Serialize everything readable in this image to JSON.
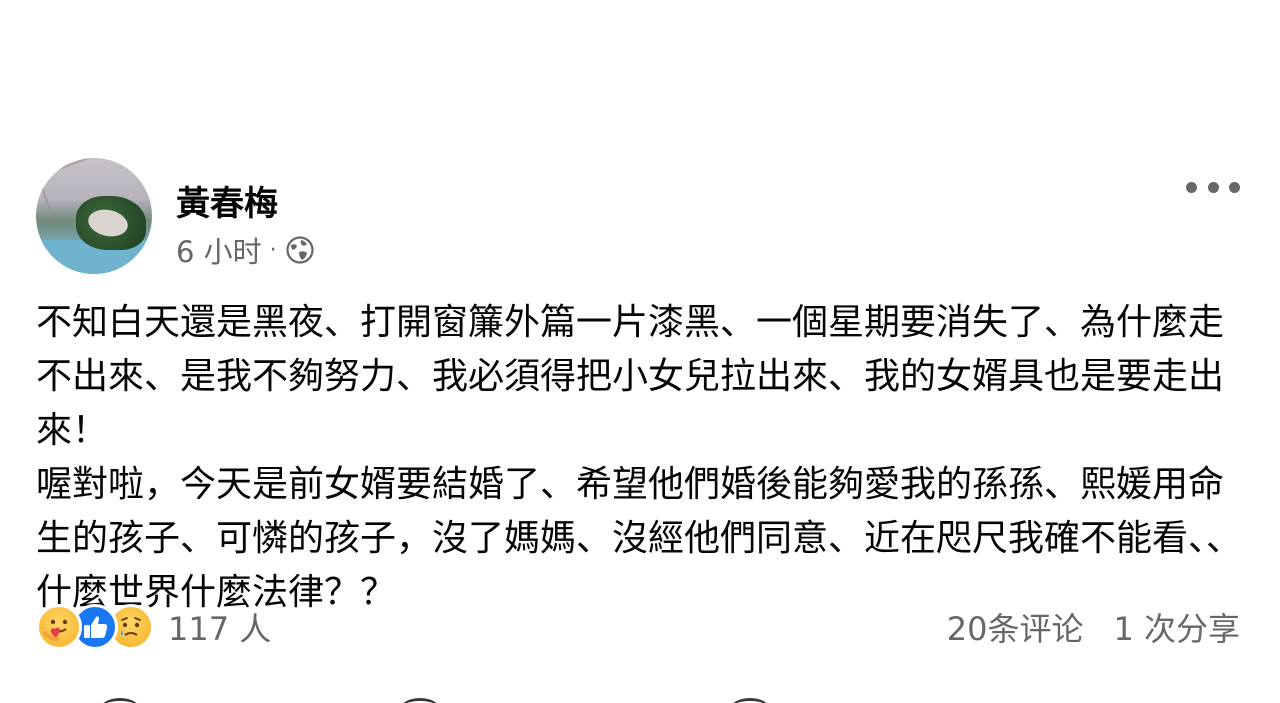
{
  "post": {
    "author": "黃春梅",
    "time": "6 小时",
    "separator": "·",
    "privacy_icon": "globe-icon",
    "more_icon": "more-dots-icon",
    "paragraphs": [
      "不知白天還是黑夜、打開窗簾外篇一片漆黑、一個星期要消失了、為什麼走不出來、是我不夠努力、我必須得把小女兒拉出來、我的女婿具也是要走出來！",
      "喔對啦，今天是前女婿要結婚了、希望他們婚後能夠愛我的孫孫、熙媛用命生的孩子、可憐的孩子，沒了媽媽、沒經他們同意、近在咫尺我確不能看、、什麼世界什麼法律？？"
    ]
  },
  "footer": {
    "reactions": [
      "care-reaction-icon",
      "like-reaction-icon",
      "sad-reaction-icon"
    ],
    "reaction_count": "117 人",
    "comments": "20条评论",
    "shares": "1 次分享"
  },
  "colors": {
    "text": "#050505",
    "secondary": "#65676b",
    "like_blue": "#1877f2"
  }
}
